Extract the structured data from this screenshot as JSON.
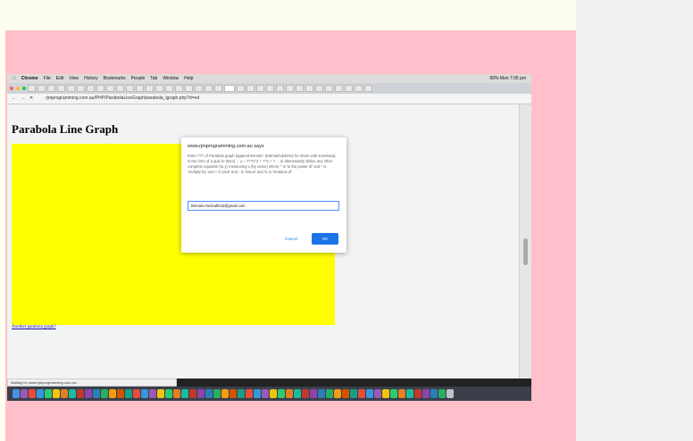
{
  "menubar": {
    "items": [
      "Chrome",
      "File",
      "Edit",
      "View",
      "History",
      "Bookmarks",
      "People",
      "Tab",
      "Window",
      "Help"
    ],
    "status_right": "99%  Mon 7:05 pm"
  },
  "address": {
    "url": "rjmprogramming.com.au/PHP/ParabolaLineGraph/parabola_lgraph.php?d=ed"
  },
  "page": {
    "title": "Parabola Line Graph",
    "link_text": "Another parabola graph?"
  },
  "dialog": {
    "title": "www.rjmprogramming.com.au says",
    "message": "Enter ??? of Parabola graph (append Bemail+ (toEmailAddress) for share with somebody in the form of a quiz to them) ... y = ???x^2 + ??x + ? ... or alternatively define any other complete equation (to y) mentioning x (by name) where ^ is 'to the power of' and * is 'multiply by' and + is 'plus' and - is 'minus' and % is 'modulus of'",
    "input_value": "Bemail=rmetcalfe15@gmail.com",
    "cancel_label": "Cancel",
    "ok_label": "OK"
  },
  "status_text": "Waiting for www.rjmprogramming.com.au..."
}
